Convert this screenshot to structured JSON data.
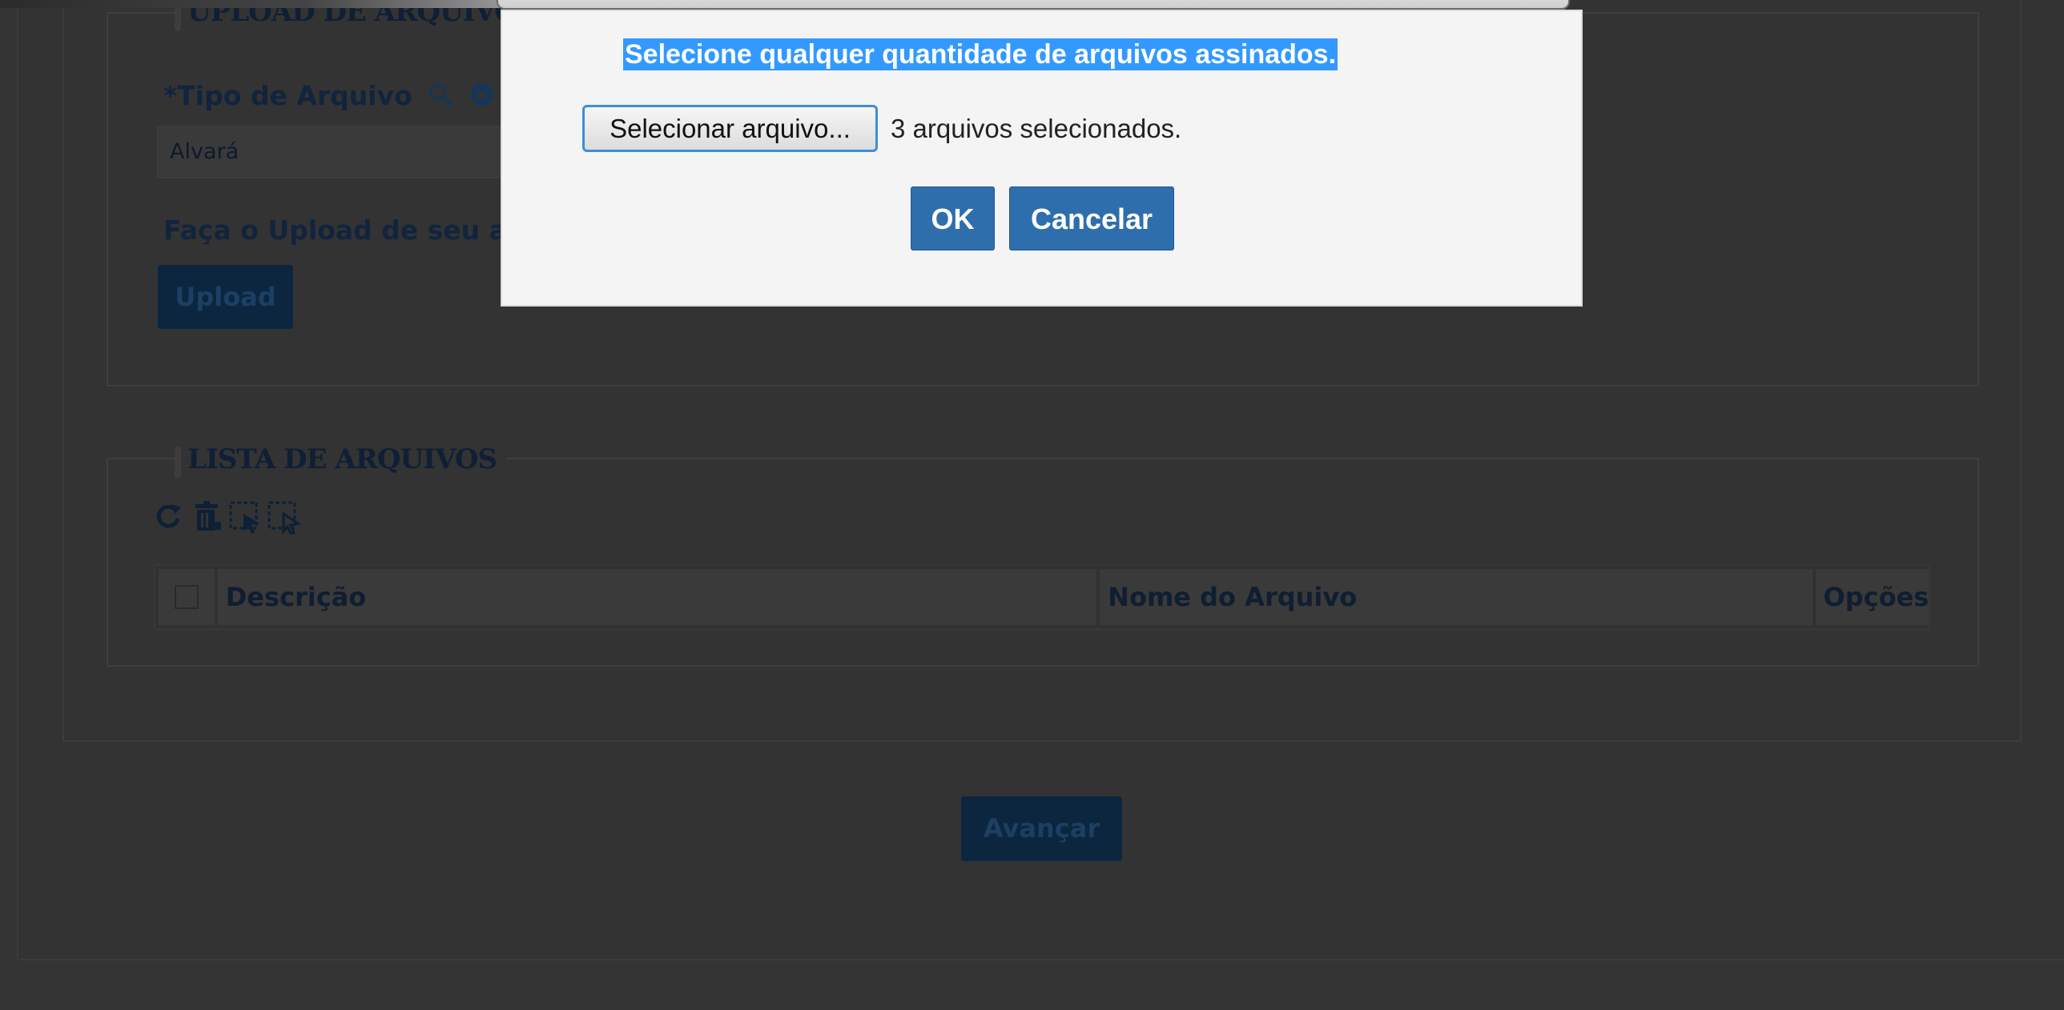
{
  "upload_section": {
    "legend": "UPLOAD DE ARQUIVO",
    "type_label": "*Tipo de Arquivo",
    "type_value": "Alvará",
    "upload_hint": "Faça o Upload de seu ar",
    "upload_button": "Upload"
  },
  "file_list": {
    "legend": "LISTA DE ARQUIVOS",
    "columns": [
      "Descrição",
      "Nome do Arquivo",
      "Opções"
    ]
  },
  "footer": {
    "advance_button": "Avançar"
  },
  "dialog": {
    "message": "Selecione qualquer quantidade de arquivos assinados.",
    "file_button": "Selecionar arquivo...",
    "file_status": "3 arquivos selecionados.",
    "ok_button": "OK",
    "cancel_button": "Cancelar"
  },
  "icons": [
    "search-icon",
    "clear-icon",
    "refresh-icon",
    "delete-icon",
    "select-all-icon",
    "deselect-all-icon"
  ],
  "colors": {
    "overlay_background": "#343434",
    "dialog_background": "#f4f4f4",
    "selection_highlight": "#3399ff",
    "dialog_button": "#2f6ead",
    "dimmed_button": "#0c2640"
  }
}
